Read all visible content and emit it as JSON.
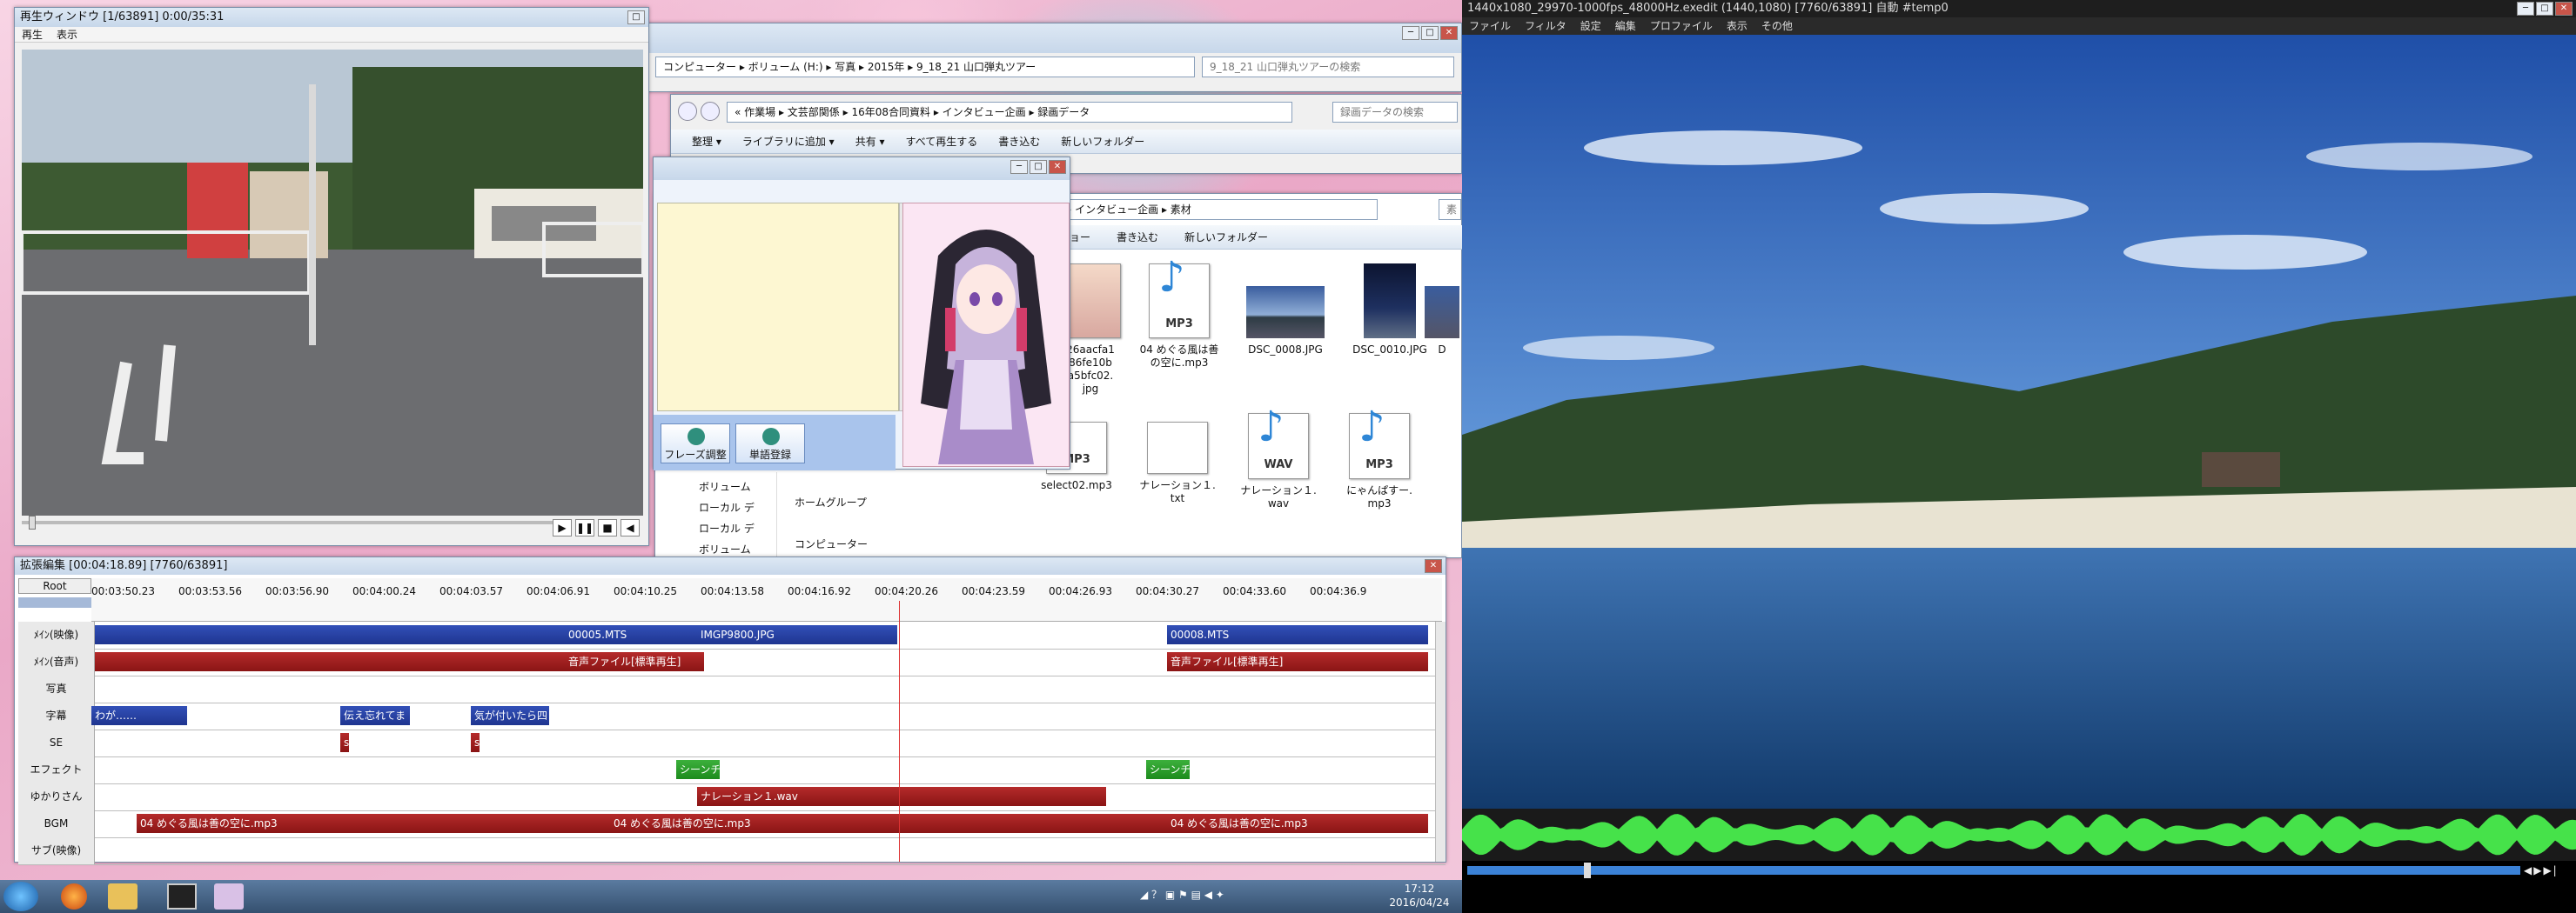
{
  "taskbar": {
    "time": "17:12",
    "date": "2016/04/24"
  },
  "player": {
    "title": "再生ウィンドウ [1/63891] 0:00/35:31",
    "menu": [
      "再生",
      "表示"
    ]
  },
  "explorer_back": {
    "path": "コンピューター ▸ ボリューム (H:) ▸ 写真 ▸ 2015年 ▸ 9_18_21 山口弾丸ツアー",
    "search": "9_18_21 山口弾丸ツアーの検索"
  },
  "explorer_mid": {
    "path": "« 作業場 ▸ 文芸部関係 ▸ 16年08合同資料 ▸ インタビュー企画 ▸ 録画データ",
    "search": "録画データの検索",
    "toolbar": [
      "整理 ▾",
      "ライブラリに追加 ▾",
      "共有 ▾",
      "すべて再生する",
      "書き込む",
      "新しいフォルダー"
    ]
  },
  "explorer_front": {
    "path": "» インタビュー企画 ▸ 素材",
    "search": "素",
    "toolbar": [
      "ショー",
      "書き込む",
      "新しいフォルダー"
    ],
    "files_row1": [
      {
        "name": "26aacfa186fe10b...a5bfc02.jpg",
        "lines": [
          "26aacfa1",
          "86fe10b",
          "a5bfc02.",
          "jpg"
        ],
        "type": "img"
      },
      {
        "name": "04 めぐる風は善の空に.mp3",
        "lines": [
          "04 めぐる風は善",
          "の空に.mp3"
        ],
        "type": "MP3"
      },
      {
        "name": "DSC_0008.JPG",
        "lines": [
          "DSC_0008.JPG"
        ],
        "type": "photo"
      },
      {
        "name": "DSC_0010.JPG",
        "lines": [
          "DSC_0010.JPG"
        ],
        "type": "photo2"
      },
      {
        "name": "D",
        "lines": [
          "D"
        ],
        "type": "photo"
      }
    ],
    "files_row2": [
      {
        "lines": [
          "select02.mp3"
        ],
        "type": "MP3"
      },
      {
        "lines": [
          "ナレーション１.",
          "txt"
        ],
        "type": "txt"
      },
      {
        "lines": [
          "ナレーション１.",
          "wav"
        ],
        "type": "WAV"
      },
      {
        "lines": [
          "にゃんぱすー.",
          "mp3"
        ],
        "type": "MP3"
      }
    ],
    "nav": [
      "ボリューム",
      "ローカル デ",
      "ローカル デ",
      "ボリューム"
    ],
    "nav2": [
      "ホームグループ",
      "コンピューター"
    ]
  },
  "yukari": {
    "btn_phrase": "フレーズ調整",
    "btn_word": "単語登録"
  },
  "timeline": {
    "title": "拡張編集 [00:04:18.89] [7760/63891]",
    "root": "Root",
    "ticks": [
      "00:03:50.23",
      "00:03:53.56",
      "00:03:56.90",
      "00:04:00.24",
      "00:04:03.57",
      "00:04:06.91",
      "00:04:10.25",
      "00:04:13.58",
      "00:04:16.92",
      "00:04:20.26",
      "00:04:23.59",
      "00:04:26.93",
      "00:04:30.27",
      "00:04:33.60",
      "00:04:36.9"
    ],
    "layers": [
      "ﾒｲﾝ(映像)",
      "ﾒｲﾝ(音声)",
      "写真",
      "字幕",
      "SE",
      "エフェクト",
      "ゆかりさん",
      "BGM",
      "サブ(映像)"
    ],
    "clips": {
      "video": [
        "00005.MTS",
        "IMGP9800.JPG",
        "00008.MTS"
      ],
      "audio": [
        "音声ファイル[標準再生]",
        "音声ファイル[標準再生]"
      ],
      "subs": [
        "わが……",
        "伝え忘れてま",
        "気が付いたら四"
      ],
      "se": [
        "s",
        "s"
      ],
      "effect": [
        "シーンチ",
        "シーンチ"
      ],
      "yukari": [
        "ナレーション１.wav"
      ],
      "bgm": [
        "04 めぐる風は善の空に.mp3",
        "04 めぐる風は善の空に.mp3",
        "04 めぐる風は善の空に.mp3"
      ]
    }
  },
  "main": {
    "title": "1440x1080_29970-1000fps_48000Hz.exedit (1440,1080) [7760/63891] 自動 #temp0",
    "menu": [
      "ファイル",
      "フィルタ",
      "設定",
      "編集",
      "プロファイル",
      "表示",
      "その他"
    ]
  },
  "colors": {
    "accent": "#1f3590",
    "audio": "#8a1515",
    "wave": "#46e24a"
  }
}
